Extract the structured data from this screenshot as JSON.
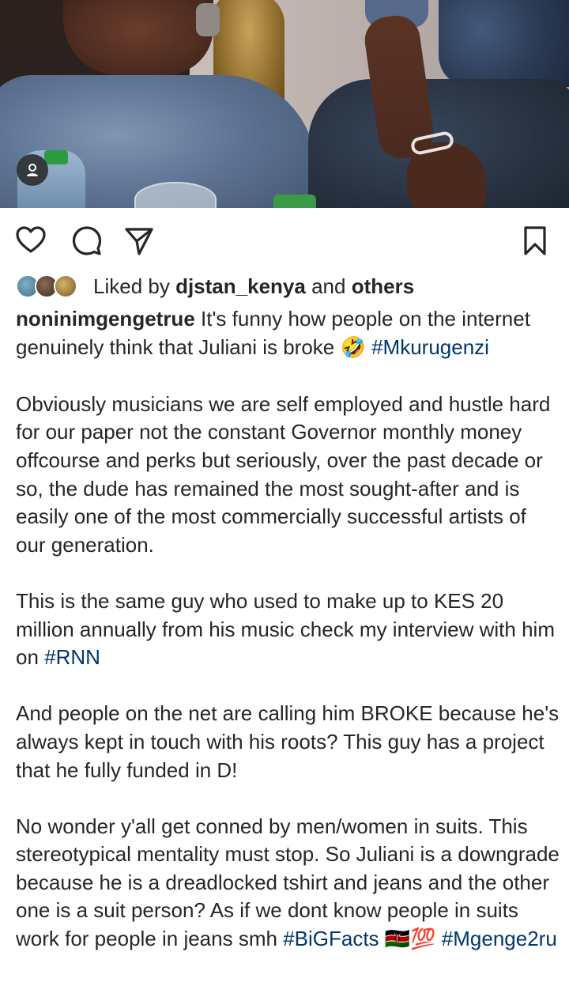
{
  "post": {
    "photo": {
      "tag_icon": "person-tag-icon"
    },
    "actions": {
      "like_icon": "heart-icon",
      "comment_icon": "comment-icon",
      "share_icon": "send-icon",
      "save_icon": "bookmark-icon"
    },
    "likes": {
      "prefix": "Liked by",
      "user": "djstan_kenya",
      "connector": "and",
      "others": "others"
    },
    "caption": {
      "username": "noninimgengetrue",
      "p1_text": "It's funny how people on the internet genuinely think that Juliani is broke",
      "p1_emoji": "🤣",
      "p1_tag": "#Mkurugenzi",
      "p2": "Obviously musicians we are self employed and hustle hard for our paper not the constant Governor monthly money offcourse and perks but seriously, over the past decade or so, the dude has remained the most sought-after and is easily one of the most commercially successful artists of our generation.",
      "p3_text": "This is the same guy who used to make up to KES 20 million annually from his music check my interview with him on",
      "p3_tag": "#RNN",
      "p4": "And people on the net are calling him BROKE because he's always kept in touch with his roots? This guy has a project that he fully funded in D!",
      "p5_text": "No wonder y'all get conned by men/women in suits. This stereotypical mentality must stop. So Juliani is a downgrade because he is a dreadlocked tshirt and jeans and the other one is a suit person? As if we dont know people in suits work for people in jeans smh",
      "p5_tag1": "#BiGFacts",
      "p5_emoji": "🇰🇪💯",
      "p5_tag2": "#Mgenge2ru"
    },
    "colors": {
      "text": "#262626",
      "hashtag": "#00376b",
      "background": "#ffffff"
    }
  }
}
